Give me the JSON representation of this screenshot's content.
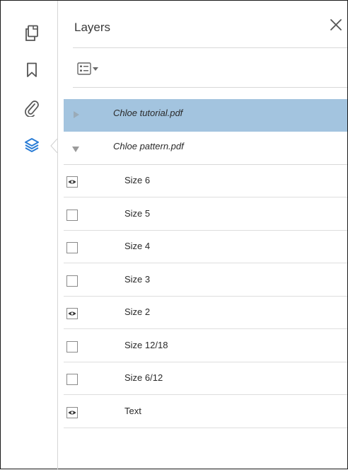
{
  "panel": {
    "title": "Layers",
    "close_icon": "close-icon",
    "options_icon": "layer-options-icon"
  },
  "rail": {
    "items": [
      {
        "name": "page-thumbnails-icon",
        "active": false
      },
      {
        "name": "bookmark-icon",
        "active": false
      },
      {
        "name": "attachment-icon",
        "active": false
      },
      {
        "name": "layers-icon",
        "active": true
      }
    ],
    "accent": "#2a7dd6"
  },
  "documents": [
    {
      "label": "Chloe tutorial.pdf",
      "expanded": false,
      "selected": true
    },
    {
      "label": "Chloe pattern.pdf",
      "expanded": true,
      "selected": false
    }
  ],
  "layers": [
    {
      "label": "Size 6",
      "visible": true
    },
    {
      "label": "Size 5",
      "visible": false
    },
    {
      "label": "Size 4",
      "visible": false
    },
    {
      "label": "Size 3",
      "visible": false
    },
    {
      "label": "Size 2",
      "visible": true
    },
    {
      "label": "Size 12/18",
      "visible": false
    },
    {
      "label": "Size 6/12",
      "visible": false
    },
    {
      "label": "Text",
      "visible": true
    }
  ],
  "colors": {
    "selected_row": "#a3c4df",
    "divider": "#d8d8d8"
  }
}
